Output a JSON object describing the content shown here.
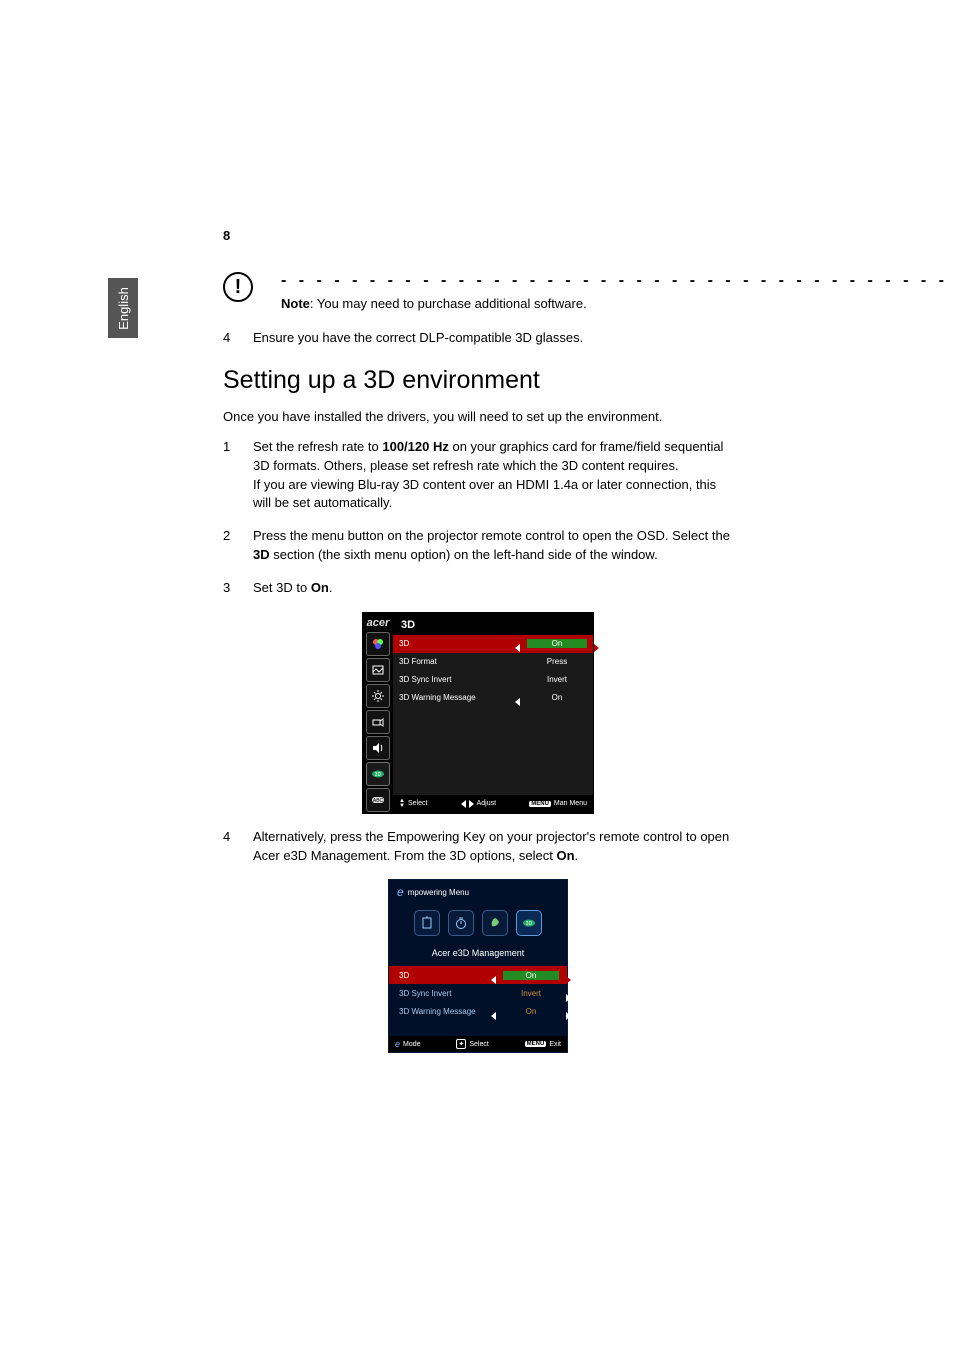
{
  "page_number": "8",
  "language_tab": "English",
  "note": {
    "label": "Note",
    "text": ": You may need to purchase additional software."
  },
  "top_steps": [
    {
      "n": "4",
      "text": "Ensure you have the correct DLP-compatible 3D glasses."
    }
  ],
  "heading": "Setting up a 3D environment",
  "intro": "Once you have installed the drivers, you will need to set up the environment.",
  "steps": [
    {
      "n": "1",
      "pre": "Set the refresh rate to ",
      "bold": "100/120 Hz",
      "post": "  on your graphics card for frame/field sequential 3D formats. Others, please set refresh rate which the 3D content requires.",
      "extra": "If you are viewing Blu-ray 3D content over an HDMI 1.4a or later connection, this will be set automatically."
    },
    {
      "n": "2",
      "pre": "Press the menu button on the projector remote control to open the OSD. Select the ",
      "bold": "3D",
      "post": " section (the sixth menu option) on the left-hand side of the window."
    },
    {
      "n": "3",
      "pre": "Set 3D to ",
      "bold": "On",
      "post": "."
    },
    {
      "n": "4",
      "pre": "Alternatively, press the Empowering Key on your projector's remote control to open Acer e3D Management. From the 3D options, select ",
      "bold": "On",
      "post": "."
    }
  ],
  "osd": {
    "brand": "acer",
    "title": "3D",
    "rows": [
      {
        "label": "3D",
        "value": "On",
        "selected": true
      },
      {
        "label": "3D Format",
        "value": "Press"
      },
      {
        "label": "3D Sync Invert",
        "value": "Invert"
      },
      {
        "label": "3D Warning Message",
        "value": "On",
        "arrows": true
      }
    ],
    "footer": {
      "select": "Select",
      "adjust": "Adjust",
      "menu_key": "MENU",
      "menu_label": "Man Menu"
    }
  },
  "emp": {
    "header": "mpowering Menu",
    "subtitle": "Acer e3D Management",
    "rows": [
      {
        "label": "3D",
        "value": "On",
        "selected": true
      },
      {
        "label": "3D Sync Invert",
        "value": "Invert"
      },
      {
        "label": "3D Warning Message",
        "value": "On",
        "arrows": true
      }
    ],
    "footer": {
      "mode": "Mode",
      "select": "Select",
      "menu_key": "MENU",
      "exit": "Exit"
    }
  }
}
